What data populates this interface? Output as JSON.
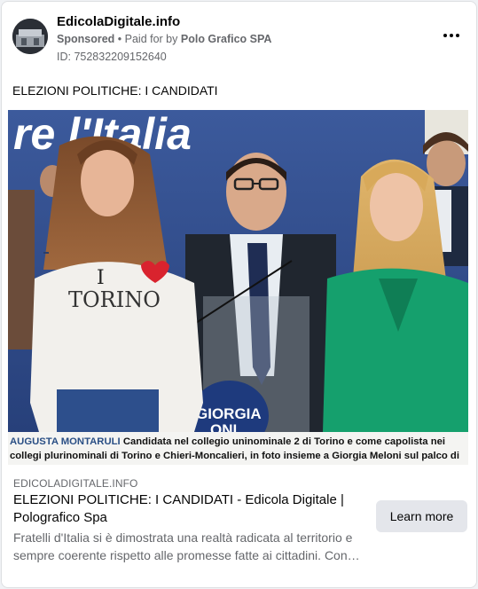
{
  "header": {
    "page_name": "EdicolaDigitale.info",
    "sponsored": "Sponsored",
    "paid_for_prefix": "• Paid for by",
    "advertiser": "Polo Grafico SPA",
    "ad_id": "ID: 752832209152640"
  },
  "post": {
    "text": "ELEZIONI POLITICHE: I CANDIDATI"
  },
  "media": {
    "banner_text": "re l'Italia",
    "shirt_text_top": "I",
    "shirt_text_city": "TORINO",
    "podium_text": "GIORGIA",
    "podium_text2": "ONI",
    "caption_name": "AUGUSTA MONTARULI",
    "caption_text": "Candidata nel collegio uninominale 2 di Torino e come capolista nei collegi plurinominali di Torino e Chieri-Moncalieri, in foto insieme a Giorgia Meloni sul palco di Torino"
  },
  "link": {
    "domain": "EDICOLADIGITALE.INFO",
    "title": "ELEZIONI POLITICHE: I CANDIDATI - Edicola Digitale | Polografico Spa",
    "description": "Fratelli d'Italia si è dimostrata una realtà radicata al territorio e sempre coerente rispetto alle promesse fatte ai cittadini. Con…",
    "cta": "Learn more"
  },
  "colors": {
    "secondary_text": "#65676b",
    "button_bg": "#e4e6eb",
    "banner_blue": "#2d4a8a",
    "caption_name": "#2a4f85"
  },
  "icons": {
    "more": "more-horizontal-icon"
  }
}
